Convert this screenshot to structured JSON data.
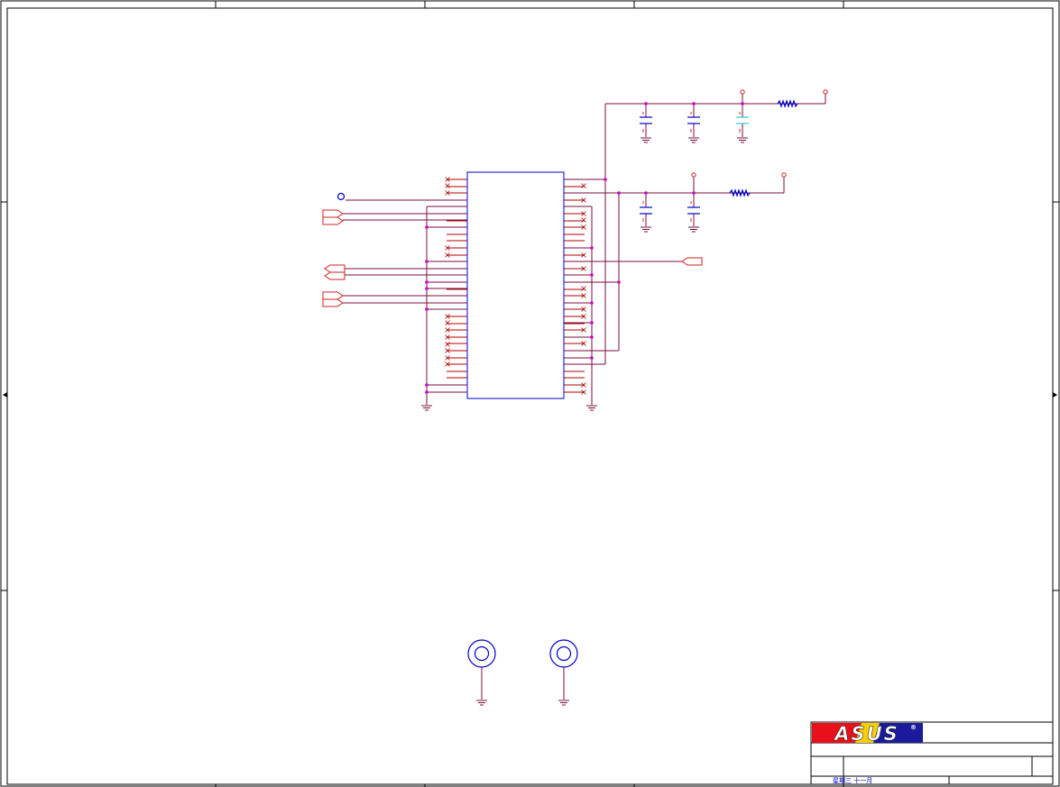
{
  "colors": {
    "border": "#000000",
    "wire": "#7a0f3d",
    "part": "#0000cc",
    "pin": "#b00000",
    "junction": "#cc00cc",
    "offpage": "#d02020",
    "cap_alt": "#33cccc",
    "logo_red": "#e8101a",
    "logo_blue": "#1a1a9c",
    "logo_yellow": "#ffd000"
  },
  "title_block": {
    "logo": "ASUS",
    "logo_mark": "®",
    "date_text": "星期三  十一月"
  }
}
